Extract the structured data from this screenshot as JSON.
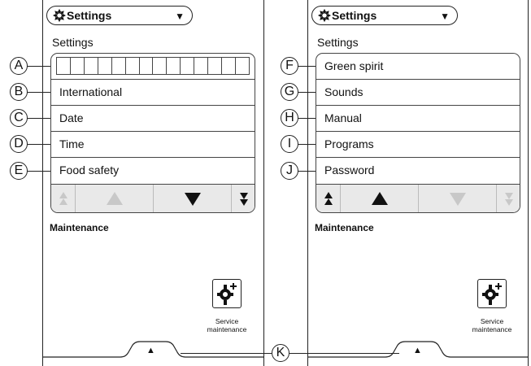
{
  "callouts": {
    "A": "A",
    "B": "B",
    "C": "C",
    "D": "D",
    "E": "E",
    "F": "F",
    "G": "G",
    "H": "H",
    "I": "I",
    "J": "J",
    "K": "K"
  },
  "left_panel": {
    "dropdown": "Settings",
    "section_title": "Settings",
    "items": [
      "International",
      "Date",
      "Time",
      "Food safety"
    ],
    "maintenance_title": "Maintenance",
    "service_label_1": "Service",
    "service_label_2": "maintenance"
  },
  "right_panel": {
    "dropdown": "Settings",
    "section_title": "Settings",
    "items": [
      "Green spirit",
      "Sounds",
      "Manual",
      "Programs",
      "Password"
    ],
    "maintenance_title": "Maintenance",
    "service_label_1": "Service",
    "service_label_2": "maintenance"
  },
  "icons": [
    "gear-icon",
    "dropdown-arrow-icon",
    "double-up-arrow-icon",
    "up-arrow-icon",
    "down-arrow-icon",
    "double-down-arrow-icon",
    "gear-plus-icon",
    "tab-up-arrow-icon"
  ],
  "colors": {
    "enabled_arrow": "#111111",
    "disabled_arrow": "#c8c8c8",
    "nav_bg": "#e9e9e9"
  }
}
